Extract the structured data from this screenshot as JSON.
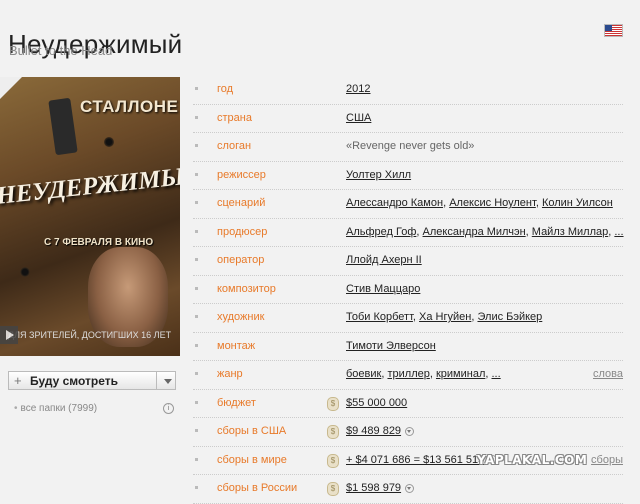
{
  "header": {
    "title": "Неудержимый",
    "subtitle": "Bullet to the Head"
  },
  "poster": {
    "actor_name": "СТАЛЛОНЕ",
    "title": "НЕУДЕРЖИМЫЙ",
    "release": "С 7 ФЕВРАЛЯ В КИНО",
    "age_note": "ДЛЯ ЗРИТЕЛЕЙ, ДОСТИГШИХ 16 ЛЕТ"
  },
  "watch": {
    "plus": "+",
    "label": "Буду смотреть"
  },
  "folders": {
    "label": "все папки (7999)"
  },
  "info_rows": [
    {
      "key": "год",
      "values": [
        "2012"
      ]
    },
    {
      "key": "страна",
      "values": [
        "США"
      ]
    },
    {
      "key": "слоган",
      "text": "«Revenge never gets old»"
    },
    {
      "key": "режиссер",
      "values": [
        "Уолтер Хилл"
      ]
    },
    {
      "key": "сценарий",
      "values": [
        "Алессандро Камон",
        "Алексис Ноулент",
        "Колин Уилсон"
      ]
    },
    {
      "key": "продюсер",
      "values": [
        "Альфред Гоф",
        "Александра Милчэн",
        "Майлз Миллар",
        "..."
      ]
    },
    {
      "key": "оператор",
      "values": [
        "Ллойд Ахерн II"
      ]
    },
    {
      "key": "композитор",
      "values": [
        "Стив Маццаро"
      ]
    },
    {
      "key": "художник",
      "values": [
        "Тоби Корбетт",
        "Ха Нгуйен",
        "Элис Бэйкер"
      ]
    },
    {
      "key": "монтаж",
      "values": [
        "Тимоти Элверсон"
      ]
    },
    {
      "key": "жанр",
      "values": [
        "боевик",
        "триллер",
        "криминал",
        "..."
      ],
      "right": "слова"
    },
    {
      "key": "бюджет",
      "values": [
        "$55 000 000"
      ],
      "coin": true
    },
    {
      "key": "сборы в США",
      "values": [
        "$9 489 829"
      ],
      "coin": true,
      "arrow": true
    },
    {
      "key": "сборы в мире",
      "values": [
        "+ $4 071 686 = $13 561 515"
      ],
      "coin": true,
      "arrow": true,
      "right": "сборы"
    },
    {
      "key": "сборы в России",
      "values": [
        "$1 598 979"
      ],
      "coin": true,
      "arrow": true
    }
  ],
  "watermark": "YAPLAKAL.COM",
  "colors": {
    "key": "#e87a2a",
    "background": "#f2f2f2"
  }
}
